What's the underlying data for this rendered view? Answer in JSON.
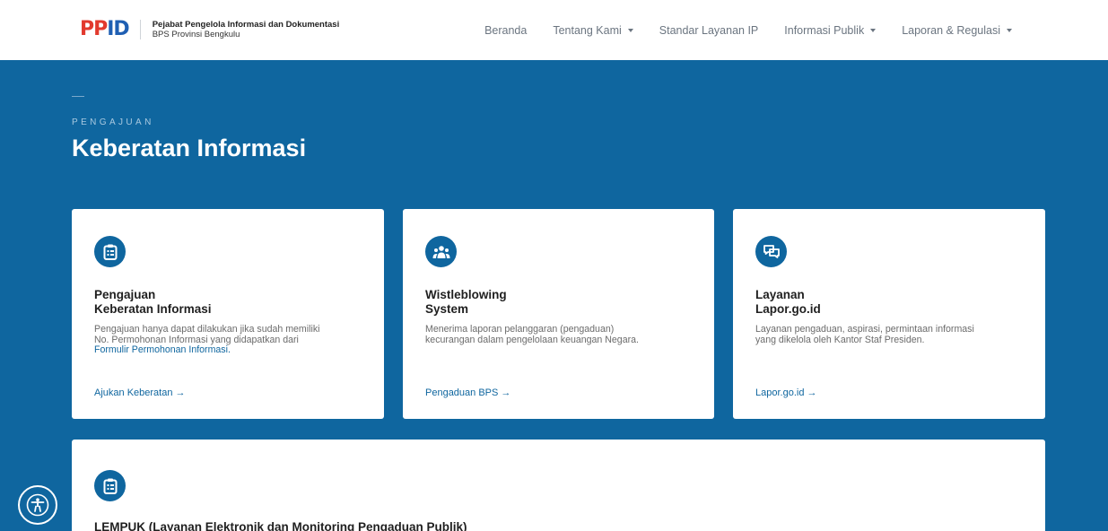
{
  "header": {
    "logo_text": "PPID",
    "brand_title": "Pejabat Pengelola Informasi dan Dokumentasi",
    "brand_sub": "BPS Provinsi Bengkulu",
    "nav": [
      {
        "label": "Beranda",
        "dropdown": false
      },
      {
        "label": "Tentang Kami",
        "dropdown": true
      },
      {
        "label": "Standar Layanan IP",
        "dropdown": false
      },
      {
        "label": "Informasi Publik",
        "dropdown": true
      },
      {
        "label": "Laporan & Regulasi",
        "dropdown": true
      }
    ]
  },
  "hero": {
    "eyebrow": "PENGAJUAN",
    "title": "Keberatan Informasi"
  },
  "cards": [
    {
      "icon": "clipboard-list-icon",
      "title_line1": "Pengajuan",
      "title_line2": "Keberatan Informasi",
      "desc_line1": "Pengajuan hanya dapat dilakukan jika sudah memiliki",
      "desc_line2": "No. Permohonan Informasi yang didapatkan dari",
      "desc_link": "Formulir Permohonan Informasi.",
      "link": "Ajukan Keberatan →"
    },
    {
      "icon": "users-group-icon",
      "title_line1": "Wistleblowing",
      "title_line2": "System",
      "desc_line1": "Menerima laporan pelanggaran (pengaduan)",
      "desc_line2": "kecurangan dalam pengelolaan keuangan Negara.",
      "link": "Pengaduan BPS →"
    },
    {
      "icon": "chat-bubbles-icon",
      "title_line1": "Layanan",
      "title_line2": "Lapor.go.id",
      "desc_line1": "Layanan pengaduan, aspirasi, permintaan informasi",
      "desc_line2": "yang dikelola oleh Kantor Staf Presiden.",
      "link": "Lapor.go.id →"
    },
    {
      "icon": "clipboard-list-icon",
      "title_line1": "LEMPUK (Layanan Elektronik dan Monitoring Pengaduan Publik)"
    }
  ],
  "colors": {
    "primary": "#0f669f",
    "logo_red": "#e23a2e",
    "logo_blue": "#1f5fb3"
  }
}
